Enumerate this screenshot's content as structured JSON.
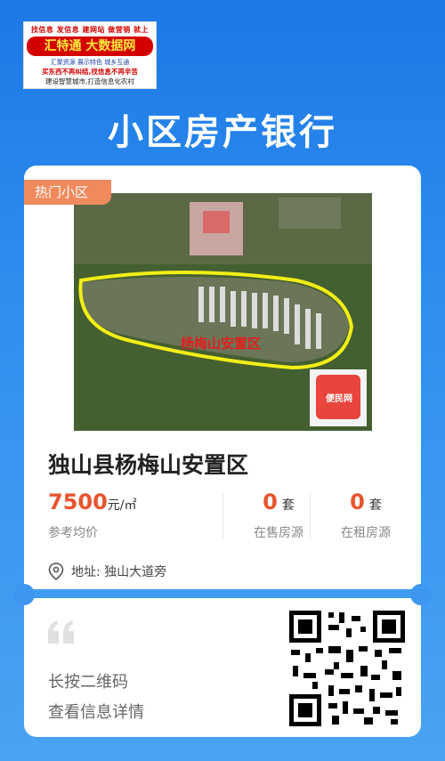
{
  "banner": {
    "row1": "找信息 发信息 建网站 做营销 就上",
    "main": "汇特通 大数据网",
    "row3": "汇聚资源 展示特色 城乡互通",
    "row4": "买东西不再纠结,找信息不再辛苦",
    "row5": "建设智慧城市,打造信息化农村"
  },
  "page_title": "小区房产银行",
  "card": {
    "tag": "热门小区",
    "photo_caption": "杨梅山安置区",
    "qr_badge": "便民网",
    "name": "独山县杨梅山安置区",
    "price_value": "7500",
    "price_unit": "元/㎡",
    "price_label": "参考均价",
    "sale_count": "0",
    "sale_suffix": "套",
    "sale_label": "在售房源",
    "rent_count": "0",
    "rent_suffix": "套",
    "rent_label": "在租房源",
    "address": "地址: 独山大道旁"
  },
  "footer": {
    "hint_line1": "长按二维码",
    "hint_line2": "查看信息详情"
  }
}
